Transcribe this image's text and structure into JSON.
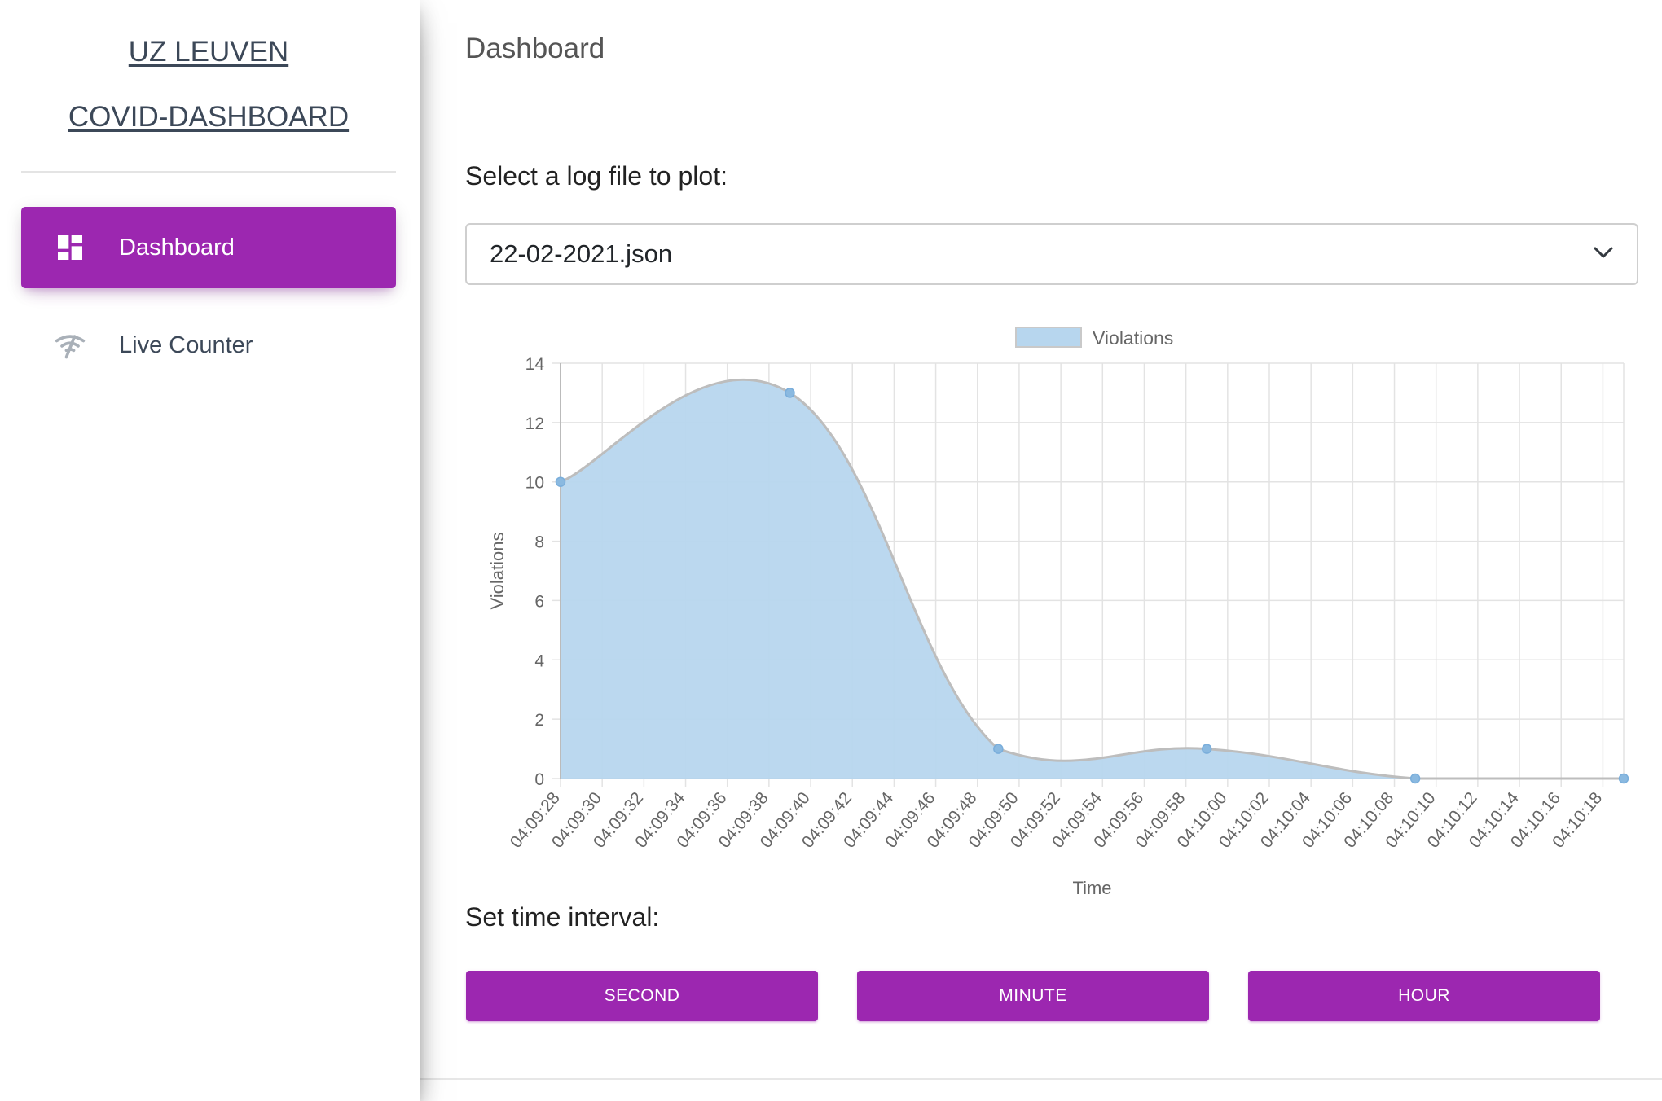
{
  "sidebar": {
    "brand_line1": "UZ LEUVEN",
    "brand_line2": "COVID-DASHBOARD",
    "items": [
      {
        "label": "Dashboard",
        "icon": "dashboard-icon",
        "active": true
      },
      {
        "label": "Live Counter",
        "icon": "wifi-off-icon",
        "active": false
      }
    ]
  },
  "main": {
    "title": "Dashboard",
    "select_label": "Select a log file to plot:",
    "select_value": "22-02-2021.json",
    "interval_label": "Set time interval:",
    "buttons": {
      "second": "SECOND",
      "minute": "MINUTE",
      "hour": "HOUR"
    }
  },
  "colors": {
    "accent": "#9c27b0",
    "area_fill": "#b7d6ee",
    "area_line": "#bdbdbd",
    "point": "#8ab9e0"
  },
  "chart_data": {
    "type": "area",
    "legend": [
      "Violations"
    ],
    "legend_position": "top-center",
    "xlabel": "Time",
    "ylabel": "Violations",
    "ylim": [
      0,
      14
    ],
    "yticks": [
      0,
      2,
      4,
      6,
      8,
      10,
      12,
      14
    ],
    "x_ticks": [
      "04:09:28",
      "04:09:30",
      "04:09:32",
      "04:09:34",
      "04:09:36",
      "04:09:38",
      "04:09:40",
      "04:09:42",
      "04:09:44",
      "04:09:46",
      "04:09:48",
      "04:09:50",
      "04:09:52",
      "04:09:54",
      "04:09:56",
      "04:09:58",
      "04:10:00",
      "04:10:02",
      "04:10:04",
      "04:10:06",
      "04:10:08",
      "04:10:10",
      "04:10:12",
      "04:10:14",
      "04:10:16",
      "04:10:18"
    ],
    "grid": true,
    "series": [
      {
        "name": "Violations",
        "x": [
          "04:09:28",
          "04:09:39",
          "04:09:49",
          "04:09:59",
          "04:10:09",
          "04:10:19"
        ],
        "values": [
          10,
          13,
          1,
          1,
          0,
          0
        ]
      }
    ]
  }
}
